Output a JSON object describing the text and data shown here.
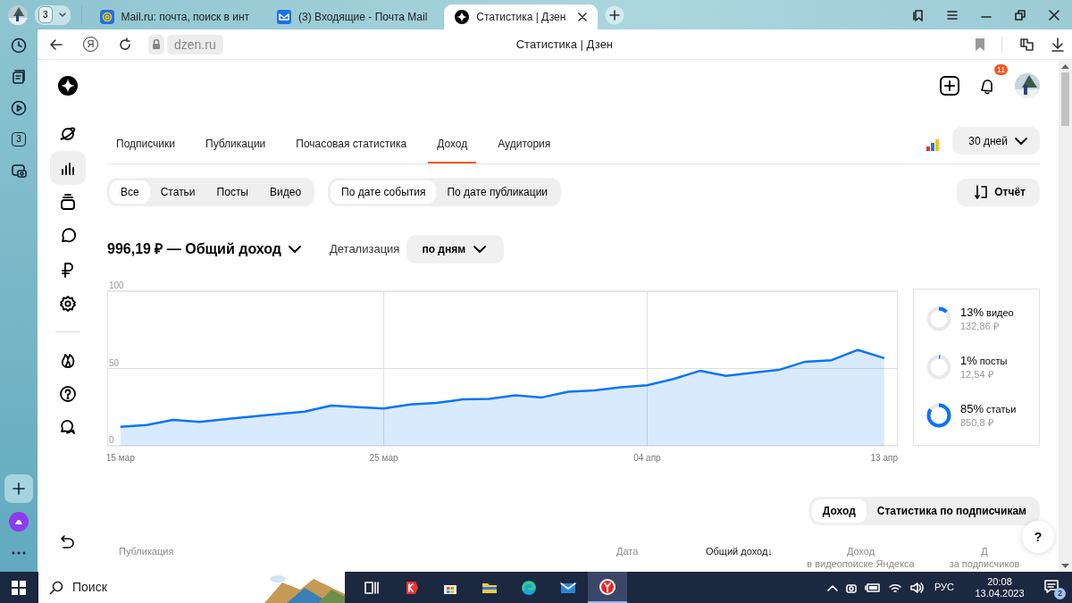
{
  "browser": {
    "tab_group": "3",
    "tabs": [
      {
        "title": "Mail.ru: почта, поиск в инт",
        "selected": false
      },
      {
        "title": "(3) Входящие - Почта Mail",
        "selected": false
      },
      {
        "title": "Статистика | Дзен",
        "selected": true
      }
    ],
    "home_glyph": "Я",
    "address": "dzen.ru",
    "page_title": "Статистика | Дзен",
    "sidebar_badge": "3"
  },
  "header": {
    "notifications": "11"
  },
  "nav_tabs": [
    {
      "label": "Подписчики",
      "selected": false
    },
    {
      "label": "Публикации",
      "selected": false
    },
    {
      "label": "Почасовая статистика",
      "selected": false
    },
    {
      "label": "Доход",
      "selected": true
    },
    {
      "label": "Аудитория",
      "selected": false
    }
  ],
  "period": "30 дней",
  "content_filters": [
    {
      "label": "Все",
      "selected": true
    },
    {
      "label": "Статьи",
      "selected": false
    },
    {
      "label": "Посты",
      "selected": false
    },
    {
      "label": "Видео",
      "selected": false
    }
  ],
  "date_filters": [
    {
      "label": "По дате события",
      "selected": true
    },
    {
      "label": "По дате публикации",
      "selected": false
    }
  ],
  "report_button": "Отчёт",
  "summary": {
    "total": "996,19 ₽ — Общий доход",
    "detail_label": "Детализация",
    "detail_value": "по дням"
  },
  "chart_data": {
    "type": "area",
    "categories": [
      "15 мар",
      null,
      null,
      null,
      null,
      null,
      null,
      null,
      null,
      null,
      "25 мар",
      null,
      null,
      null,
      null,
      null,
      null,
      null,
      null,
      null,
      "04 апр",
      null,
      null,
      null,
      null,
      null,
      null,
      null,
      null,
      "13 апр"
    ],
    "series": [
      {
        "color": "#0a75f5",
        "values": [
          12.3,
          13.4,
          16.8,
          15.5,
          17.2,
          18.9,
          20.5,
          22.1,
          26,
          25,
          24.1,
          26.7,
          27.7,
          30,
          30.3,
          32.6,
          31.3,
          35,
          35.9,
          37.9,
          39.2,
          43.2,
          48.5,
          45.2,
          47.2,
          49.1,
          54.4,
          55.4,
          62,
          56.7
        ]
      }
    ],
    "ylim": [
      0,
      100
    ],
    "yticks": [
      0,
      50,
      100
    ],
    "grid": true
  },
  "breakdown": [
    {
      "percent": "13%",
      "label": "видео",
      "amount": "132,86 ₽",
      "level": 0.13
    },
    {
      "percent": "1%",
      "label": "посты",
      "amount": "12,54 ₽",
      "level": 0.01
    },
    {
      "percent": "85%",
      "label": "статьи",
      "amount": "850,8 ₽",
      "level": 0.85
    }
  ],
  "table_toggle": [
    {
      "label": "Доход",
      "selected": true
    },
    {
      "label": "Статистика по подписчикам",
      "selected": false
    }
  ],
  "help_button": "?",
  "table": {
    "columns": [
      {
        "lines": [
          "Публикация"
        ]
      },
      {
        "lines": [
          "Дата"
        ]
      },
      {
        "lines": [
          "Общий доход↓"
        ]
      },
      {
        "lines": [
          "Доход",
          "в видеопоиске Яндекса"
        ]
      },
      {
        "lines": [
          "Д",
          "за подписчиков"
        ]
      }
    ]
  },
  "taskbar": {
    "search_placeholder": "Поиск",
    "language": "РУС",
    "time": "20:08",
    "date": "13.04.2023",
    "notifications": "2"
  }
}
